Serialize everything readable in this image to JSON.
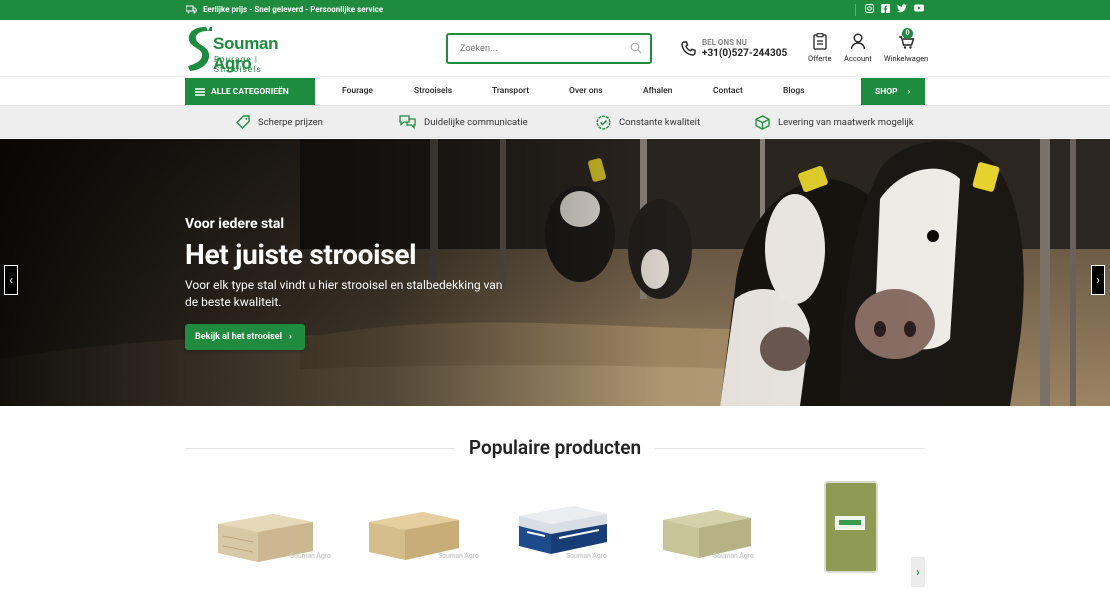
{
  "topbar": {
    "usp_text": "Eerlijke prijs - Snel geleverd - Persoonlijke service",
    "social_icons": [
      "instagram-icon",
      "facebook-icon",
      "twitter-icon",
      "youtube-icon"
    ]
  },
  "logo": {
    "brand": "Souman Agro",
    "subtitle": "Fourage | Strooisels"
  },
  "search": {
    "placeholder": "Zoeken..."
  },
  "contact": {
    "label": "BEL ONS NU",
    "phone": "+31(0)527-244305"
  },
  "header_icons": {
    "quote_label": "Offerte",
    "account_label": "Account",
    "cart_label": "Winkelwagen",
    "cart_count": "0"
  },
  "nav": {
    "categories_label": "ALLE CATEGORIEËN",
    "links": [
      "Fourage",
      "Strooisels",
      "Transport",
      "Over ons",
      "Afhalen",
      "Contact",
      "Blogs"
    ],
    "shop_label": "SHOP"
  },
  "usps": [
    "Scherpe prijzen",
    "Duidelijke communicatie",
    "Constante kwaliteit",
    "Levering van maatwerk mogelijk"
  ],
  "hero": {
    "pretitle": "Voor iedere stal",
    "title": "Het juiste strooisel",
    "description": "Voor elk type stal vindt u hier strooisel en stalbedekking van de beste kwaliteit.",
    "cta_label": "Bekijk al het strooisel"
  },
  "popular": {
    "title": "Populaire producten",
    "watermark": "Souman Agro"
  },
  "colors": {
    "brand_green": "#1f8b3e",
    "usp_bar": "#eeeeee"
  }
}
